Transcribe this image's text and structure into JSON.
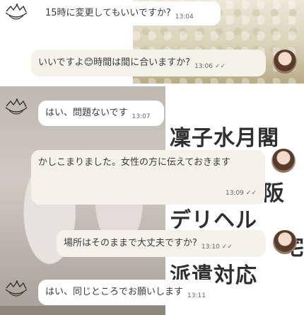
{
  "headline": {
    "line1": "凜子水月閣",
    "line2": "阪",
    "line3": "デリヘル",
    "line4": "宅",
    "line5": "派遣対応"
  },
  "messages": [
    {
      "text": "15時に変更してもいいですか?",
      "time": "13:04",
      "from": "them"
    },
    {
      "text": "いいですよ😊時間は間に合いますか?",
      "time": "13:06",
      "read_mark": "✓✓",
      "from": "me"
    },
    {
      "text": "はい、問題ないです",
      "time": "13:07",
      "from": "them"
    },
    {
      "text": "かしこまりました。女性の方に伝えておきます",
      "time": "13:09",
      "read_mark": "✓✓",
      "from": "me"
    },
    {
      "text": "場所はそのままで大丈夫ですか?",
      "time": "13:10",
      "read_mark": "✓✓",
      "from": "me"
    },
    {
      "text": "はい、同じところでお願いします",
      "time": "13:11",
      "from": "them"
    }
  ],
  "icons": {
    "them_avatar": "crown-logo-icon",
    "me_avatar": "girl-avatar-icon"
  }
}
